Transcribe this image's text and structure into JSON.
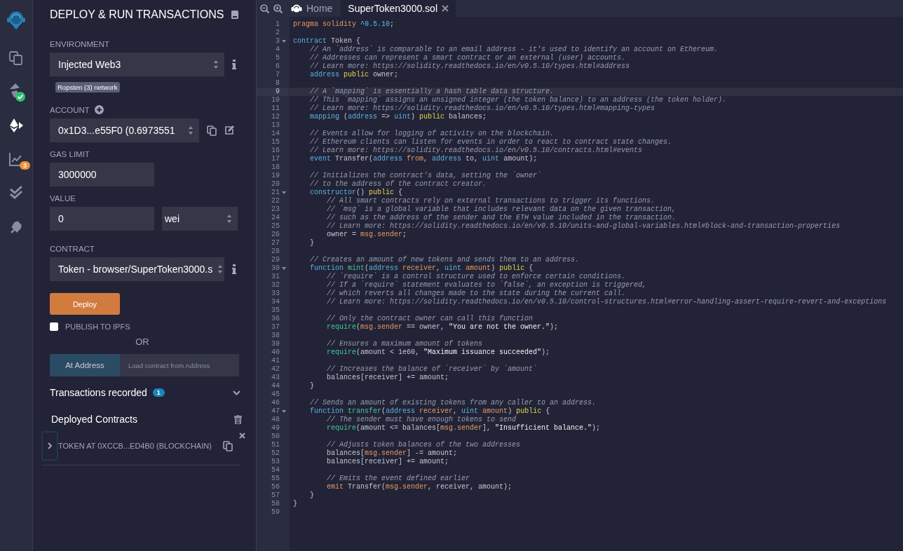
{
  "icon_bar": [
    {
      "kind": "logo"
    },
    {
      "kind": "files",
      "selected": false
    },
    {
      "kind": "compiler",
      "selected": false
    },
    {
      "kind": "deploy",
      "selected": true
    },
    {
      "kind": "analysis",
      "selected": false,
      "badge": "3"
    },
    {
      "kind": "tests",
      "selected": false
    },
    {
      "kind": "plugins",
      "selected": false
    }
  ],
  "panel": {
    "title": "DEPLOY & RUN TRANSACTIONS",
    "environment": {
      "label": "ENVIRONMENT",
      "value": "Injected Web3",
      "network": "Ropsten (3) network"
    },
    "account": {
      "label": "ACCOUNT",
      "value": "0x1D3...e55F0 (0.6973551"
    },
    "gas_limit": {
      "label": "GAS LIMIT",
      "value": "3000000"
    },
    "value": {
      "label": "VALUE",
      "amount": "0",
      "unit": "wei"
    },
    "contract": {
      "label": "CONTRACT",
      "value": "Token - browser/SuperToken3000.s"
    },
    "deploy_button": "Deploy",
    "publish": {
      "label": "PUBLISH TO IPFS",
      "checked": false
    },
    "or_label": "OR",
    "at_address": {
      "button": "At Address",
      "placeholder": "Load contract from Address"
    },
    "transactions": {
      "label": "Transactions recorded",
      "count": "1",
      "expanded": false
    },
    "deployed": {
      "label": "Deployed Contracts",
      "instances": [
        {
          "label": "TOKEN AT 0XCCB...ED4B0 (BLOCKCHAIN)",
          "expanded": false
        }
      ]
    }
  },
  "editor": {
    "tabs": [
      {
        "kind": "home",
        "label": "Home",
        "selected": false,
        "closable": false
      },
      {
        "kind": "file",
        "label": "SuperToken3000.sol",
        "selected": true,
        "closable": true
      }
    ],
    "lines": [
      {
        "number": "1",
        "highlighted": false,
        "foldable": false,
        "tokens": [
          {
            "kind": "orange",
            "text": "pragma solidity "
          },
          {
            "kind": "number",
            "text": "^0.5.10"
          },
          {
            "kind": "plain",
            "text": ";"
          }
        ]
      },
      {
        "number": "2",
        "highlighted": false,
        "foldable": false
      },
      {
        "number": "3",
        "highlighted": false,
        "foldable": true,
        "tokens": [
          {
            "kind": "keyword",
            "text": "contract"
          },
          {
            "kind": "plain",
            "text": " Token {"
          }
        ]
      },
      {
        "number": "4",
        "highlighted": false,
        "foldable": false,
        "tokens": [
          {
            "kind": "comment",
            "text": "    // An `address` is comparable to an email address - it's used to identify an account on Ethereum."
          }
        ]
      },
      {
        "number": "5",
        "highlighted": false,
        "foldable": false,
        "tokens": [
          {
            "kind": "comment",
            "text": "    // Addresses can represent a smart contract or an external (user) accounts."
          }
        ]
      },
      {
        "number": "6",
        "highlighted": false,
        "foldable": false,
        "tokens": [
          {
            "kind": "comment",
            "text": "    // Learn more: https://solidity.readthedocs.io/en/v0.5.10/types.html#address"
          }
        ]
      },
      {
        "number": "7",
        "highlighted": false,
        "foldable": false,
        "tokens": [
          {
            "kind": "keyword",
            "text": "    address "
          },
          {
            "kind": "modifier",
            "text": "public"
          },
          {
            "kind": "plain",
            "text": " owner;"
          }
        ]
      },
      {
        "number": "8",
        "highlighted": false,
        "foldable": false
      },
      {
        "number": "9",
        "highlighted": true,
        "foldable": false,
        "tokens": [
          {
            "kind": "comment",
            "text": "    // A `mapping` is essentially a hash table data structure."
          }
        ]
      },
      {
        "number": "10",
        "highlighted": false,
        "foldable": false,
        "tokens": [
          {
            "kind": "comment",
            "text": "    // This `mapping` assigns an unsigned integer (the token balance) to an address (the token holder)."
          }
        ]
      },
      {
        "number": "11",
        "highlighted": false,
        "foldable": false,
        "tokens": [
          {
            "kind": "comment",
            "text": "    // Learn more: https://solidity.readthedocs.io/en/v0.5.10/types.html#mapping-types"
          }
        ]
      },
      {
        "number": "12",
        "highlighted": false,
        "foldable": false,
        "tokens": [
          {
            "kind": "keyword",
            "text": "    mapping"
          },
          {
            "kind": "plain",
            "text": " ("
          },
          {
            "kind": "keyword",
            "text": "address"
          },
          {
            "kind": "plain",
            "text": " => "
          },
          {
            "kind": "keyword",
            "text": "uint"
          },
          {
            "kind": "plain",
            "text": ") "
          },
          {
            "kind": "modifier",
            "text": "public"
          },
          {
            "kind": "plain",
            "text": " balances;"
          }
        ]
      },
      {
        "number": "13",
        "highlighted": false,
        "foldable": false
      },
      {
        "number": "14",
        "highlighted": false,
        "foldable": false,
        "tokens": [
          {
            "kind": "comment",
            "text": "    // Events allow for logging of activity on the blockchain."
          }
        ]
      },
      {
        "number": "15",
        "highlighted": false,
        "foldable": false,
        "tokens": [
          {
            "kind": "comment",
            "text": "    // Ethereum clients can listen for events in order to react to contract state changes."
          }
        ]
      },
      {
        "number": "16",
        "highlighted": false,
        "foldable": false,
        "tokens": [
          {
            "kind": "comment",
            "text": "    // Learn more: https://solidity.readthedocs.io/en/v0.5.10/contracts.html#events"
          }
        ]
      },
      {
        "number": "17",
        "highlighted": false,
        "foldable": false,
        "tokens": [
          {
            "kind": "keyword",
            "text": "    event"
          },
          {
            "kind": "plain",
            "text": " Transfer("
          },
          {
            "kind": "keyword",
            "text": "address "
          },
          {
            "kind": "orange",
            "text": "from"
          },
          {
            "kind": "plain",
            "text": ", "
          },
          {
            "kind": "keyword",
            "text": "address"
          },
          {
            "kind": "plain",
            "text": " to, "
          },
          {
            "kind": "keyword",
            "text": "uint"
          },
          {
            "kind": "plain",
            "text": " amount);"
          }
        ]
      },
      {
        "number": "18",
        "highlighted": false,
        "foldable": false
      },
      {
        "number": "19",
        "highlighted": false,
        "foldable": false,
        "tokens": [
          {
            "kind": "comment",
            "text": "    // Initializes the contract's data, setting the `owner`"
          }
        ]
      },
      {
        "number": "20",
        "highlighted": false,
        "foldable": false,
        "tokens": [
          {
            "kind": "comment",
            "text": "    // to the address of the contract creator."
          }
        ]
      },
      {
        "number": "21",
        "highlighted": false,
        "foldable": true,
        "tokens": [
          {
            "kind": "keyword",
            "text": "    constructor"
          },
          {
            "kind": "plain",
            "text": "() "
          },
          {
            "kind": "modifier",
            "text": "public"
          },
          {
            "kind": "plain",
            "text": " {"
          }
        ]
      },
      {
        "number": "22",
        "highlighted": false,
        "foldable": false,
        "tokens": [
          {
            "kind": "comment",
            "text": "        // All smart contracts rely on external transactions to trigger its functions."
          }
        ]
      },
      {
        "number": "23",
        "highlighted": false,
        "foldable": false,
        "tokens": [
          {
            "kind": "comment",
            "text": "        // `msg` is a global variable that includes relevant data on the given transaction,"
          }
        ]
      },
      {
        "number": "24",
        "highlighted": false,
        "foldable": false,
        "tokens": [
          {
            "kind": "comment",
            "text": "        // such as the address of the sender and the ETH value included in the transaction."
          }
        ]
      },
      {
        "number": "25",
        "highlighted": false,
        "foldable": false,
        "tokens": [
          {
            "kind": "comment",
            "text": "        // Learn more: https://solidity.readthedocs.io/en/v0.5.10/units-and-global-variables.html#block-and-transaction-properties"
          }
        ]
      },
      {
        "number": "26",
        "highlighted": false,
        "foldable": false,
        "tokens": [
          {
            "kind": "plain",
            "text": "        owner = "
          },
          {
            "kind": "orange",
            "text": "msg.sender"
          },
          {
            "kind": "plain",
            "text": ";"
          }
        ]
      },
      {
        "number": "27",
        "highlighted": false,
        "foldable": false,
        "tokens": [
          {
            "kind": "plain",
            "text": "    }"
          }
        ]
      },
      {
        "number": "28",
        "highlighted": false,
        "foldable": false
      },
      {
        "number": "29",
        "highlighted": false,
        "foldable": false,
        "tokens": [
          {
            "kind": "comment",
            "text": "    // Creates an amount of new tokens and sends them to an address."
          }
        ]
      },
      {
        "number": "30",
        "highlighted": false,
        "foldable": true,
        "tokens": [
          {
            "kind": "keyword",
            "text": "    function "
          },
          {
            "kind": "call",
            "text": "mint"
          },
          {
            "kind": "plain",
            "text": "("
          },
          {
            "kind": "keyword",
            "text": "address "
          },
          {
            "kind": "orange",
            "text": "receiver"
          },
          {
            "kind": "plain",
            "text": ", "
          },
          {
            "kind": "keyword",
            "text": "uint "
          },
          {
            "kind": "orange",
            "text": "amount"
          },
          {
            "kind": "plain",
            "text": ") "
          },
          {
            "kind": "modifier",
            "text": "public"
          },
          {
            "kind": "plain",
            "text": " {"
          }
        ]
      },
      {
        "number": "31",
        "highlighted": false,
        "foldable": false,
        "tokens": [
          {
            "kind": "comment",
            "text": "        // `require` is a control structure used to enforce certain conditions."
          }
        ]
      },
      {
        "number": "32",
        "highlighted": false,
        "foldable": false,
        "tokens": [
          {
            "kind": "comment",
            "text": "        // If a `require` statement evaluates to `false`, an exception is triggered,"
          }
        ]
      },
      {
        "number": "33",
        "highlighted": false,
        "foldable": false,
        "tokens": [
          {
            "kind": "comment",
            "text": "        // which reverts all changes made to the state during the current call."
          }
        ]
      },
      {
        "number": "34",
        "highlighted": false,
        "foldable": false,
        "tokens": [
          {
            "kind": "comment",
            "text": "        // Learn more: https://solidity.readthedocs.io/en/v0.5.10/control-structures.html#error-handling-assert-require-revert-and-exceptions"
          }
        ]
      },
      {
        "number": "35",
        "highlighted": false,
        "foldable": false
      },
      {
        "number": "36",
        "highlighted": false,
        "foldable": false,
        "tokens": [
          {
            "kind": "comment",
            "text": "        // Only the contract owner can call this function"
          }
        ]
      },
      {
        "number": "37",
        "highlighted": false,
        "foldable": false,
        "tokens": [
          {
            "kind": "call",
            "text": "        require"
          },
          {
            "kind": "plain",
            "text": "("
          },
          {
            "kind": "orange",
            "text": "msg.sender"
          },
          {
            "kind": "plain",
            "text": " == owner, "
          },
          {
            "kind": "string",
            "text": "\"You are not the owner.\""
          },
          {
            "kind": "plain",
            "text": ");"
          }
        ]
      },
      {
        "number": "38",
        "highlighted": false,
        "foldable": false
      },
      {
        "number": "39",
        "highlighted": false,
        "foldable": false,
        "tokens": [
          {
            "kind": "comment",
            "text": "        // Ensures a maximum amount of tokens"
          }
        ]
      },
      {
        "number": "40",
        "highlighted": false,
        "foldable": false,
        "tokens": [
          {
            "kind": "call",
            "text": "        require"
          },
          {
            "kind": "plain",
            "text": "(amount < 1e60, "
          },
          {
            "kind": "string",
            "text": "\"Maximum issuance succeeded\""
          },
          {
            "kind": "plain",
            "text": ");"
          }
        ]
      },
      {
        "number": "41",
        "highlighted": false,
        "foldable": false
      },
      {
        "number": "42",
        "highlighted": false,
        "foldable": false,
        "tokens": [
          {
            "kind": "comment",
            "text": "        // Increases the balance of `receiver` by `amount`"
          }
        ]
      },
      {
        "number": "43",
        "highlighted": false,
        "foldable": false,
        "tokens": [
          {
            "kind": "plain",
            "text": "        balances[receiver] += amount;"
          }
        ]
      },
      {
        "number": "44",
        "highlighted": false,
        "foldable": false,
        "tokens": [
          {
            "kind": "plain",
            "text": "    }"
          }
        ]
      },
      {
        "number": "45",
        "highlighted": false,
        "foldable": false
      },
      {
        "number": "46",
        "highlighted": false,
        "foldable": false,
        "tokens": [
          {
            "kind": "comment",
            "text": "    // Sends an amount of existing tokens from any caller to an address."
          }
        ]
      },
      {
        "number": "47",
        "highlighted": false,
        "foldable": true,
        "tokens": [
          {
            "kind": "keyword",
            "text": "    function "
          },
          {
            "kind": "call",
            "text": "transfer"
          },
          {
            "kind": "plain",
            "text": "("
          },
          {
            "kind": "keyword",
            "text": "address "
          },
          {
            "kind": "orange",
            "text": "receiver"
          },
          {
            "kind": "plain",
            "text": ", "
          },
          {
            "kind": "keyword",
            "text": "uint "
          },
          {
            "kind": "orange",
            "text": "amount"
          },
          {
            "kind": "plain",
            "text": ") "
          },
          {
            "kind": "modifier",
            "text": "public"
          },
          {
            "kind": "plain",
            "text": " {"
          }
        ]
      },
      {
        "number": "48",
        "highlighted": false,
        "foldable": false,
        "tokens": [
          {
            "kind": "comment",
            "text": "        // The sender must have enough tokens to send"
          }
        ]
      },
      {
        "number": "49",
        "highlighted": false,
        "foldable": false,
        "tokens": [
          {
            "kind": "call",
            "text": "        require"
          },
          {
            "kind": "plain",
            "text": "(amount <= balances["
          },
          {
            "kind": "orange",
            "text": "msg.sender"
          },
          {
            "kind": "plain",
            "text": "], "
          },
          {
            "kind": "string",
            "text": "\"Insufficient balance.\""
          },
          {
            "kind": "plain",
            "text": ");"
          }
        ]
      },
      {
        "number": "50",
        "highlighted": false,
        "foldable": false
      },
      {
        "number": "51",
        "highlighted": false,
        "foldable": false,
        "tokens": [
          {
            "kind": "comment",
            "text": "        // Adjusts token balances of the two addresses"
          }
        ]
      },
      {
        "number": "52",
        "highlighted": false,
        "foldable": false,
        "tokens": [
          {
            "kind": "plain",
            "text": "        balances["
          },
          {
            "kind": "orange",
            "text": "msg.sender"
          },
          {
            "kind": "plain",
            "text": "] -= amount;"
          }
        ]
      },
      {
        "number": "53",
        "highlighted": false,
        "foldable": false,
        "tokens": [
          {
            "kind": "plain",
            "text": "        balances[receiver] += amount;"
          }
        ]
      },
      {
        "number": "54",
        "highlighted": false,
        "foldable": false
      },
      {
        "number": "55",
        "highlighted": false,
        "foldable": false,
        "tokens": [
          {
            "kind": "comment",
            "text": "        // Emits the event defined earlier"
          }
        ]
      },
      {
        "number": "56",
        "highlighted": false,
        "foldable": false,
        "tokens": [
          {
            "kind": "orange",
            "text": "        emit"
          },
          {
            "kind": "plain",
            "text": " Transfer("
          },
          {
            "kind": "orange",
            "text": "msg.sender"
          },
          {
            "kind": "plain",
            "text": ", receiver, amount);"
          }
        ]
      },
      {
        "number": "57",
        "highlighted": false,
        "foldable": false,
        "tokens": [
          {
            "kind": "plain",
            "text": "    }"
          }
        ]
      },
      {
        "number": "58",
        "highlighted": false,
        "foldable": false,
        "tokens": [
          {
            "kind": "plain",
            "text": "}"
          }
        ]
      },
      {
        "number": "59",
        "highlighted": false,
        "foldable": false
      }
    ]
  }
}
